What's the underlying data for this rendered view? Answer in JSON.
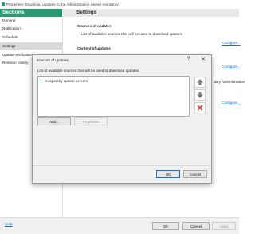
{
  "window": {
    "title": "Properties: Download updates to the Administration Server repository"
  },
  "nav": {
    "header": "Sections",
    "items": [
      {
        "label": "General",
        "selected": false
      },
      {
        "label": "Notification",
        "selected": false
      },
      {
        "label": "Schedule",
        "selected": false
      },
      {
        "label": "Settings",
        "selected": true
      },
      {
        "label": "Update verification",
        "selected": false
      },
      {
        "label": "Revision history",
        "selected": false
      }
    ]
  },
  "content": {
    "header": "Settings",
    "sources_heading": "Sources of updates",
    "sources_desc": "List of available sources that will be used to download updates.",
    "configure_label": "Configure...",
    "content_heading": "Content of updates",
    "partial_text": "dary Administration"
  },
  "footer": {
    "help": "Help",
    "ok": "OK",
    "cancel": "Cancel",
    "apply": "Apply"
  },
  "dialog": {
    "title": "Sources of updates",
    "help_icon": "?",
    "close_icon": "✕",
    "description": "List of available sources that will be used to download updates.",
    "sources": [
      "Kaspersky update servers"
    ],
    "add_label": "Add...",
    "properties_label": "Properties",
    "ok_label": "OK",
    "cancel_label": "Cancel",
    "icons": {
      "up": "arrow-up-icon",
      "down": "arrow-down-icon",
      "delete": "delete-x-icon"
    }
  }
}
